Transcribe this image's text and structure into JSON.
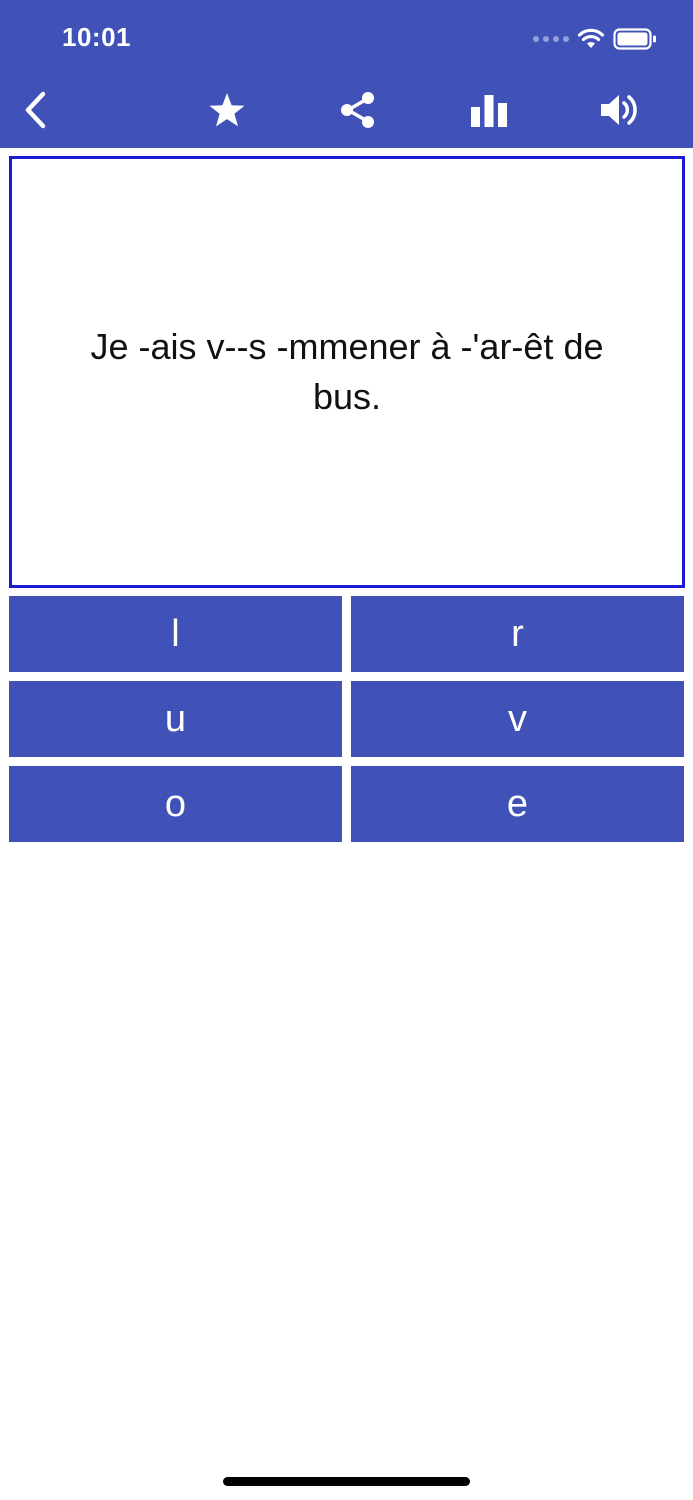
{
  "status_bar": {
    "time": "10:01"
  },
  "toolbar": {
    "icons": [
      "back-chevron-icon",
      "star-icon",
      "share-icon",
      "stats-icon",
      "speaker-icon"
    ]
  },
  "question": {
    "text": "Je -ais v--s -mmener à -'ar-êt de bus."
  },
  "answers": [
    {
      "label": "l"
    },
    {
      "label": "r"
    },
    {
      "label": "u"
    },
    {
      "label": "v"
    },
    {
      "label": "o"
    },
    {
      "label": "e"
    }
  ],
  "colors": {
    "primary": "#4052b8",
    "card_border": "#1a1ad4",
    "background": "#ffffff",
    "text": "#111111"
  }
}
